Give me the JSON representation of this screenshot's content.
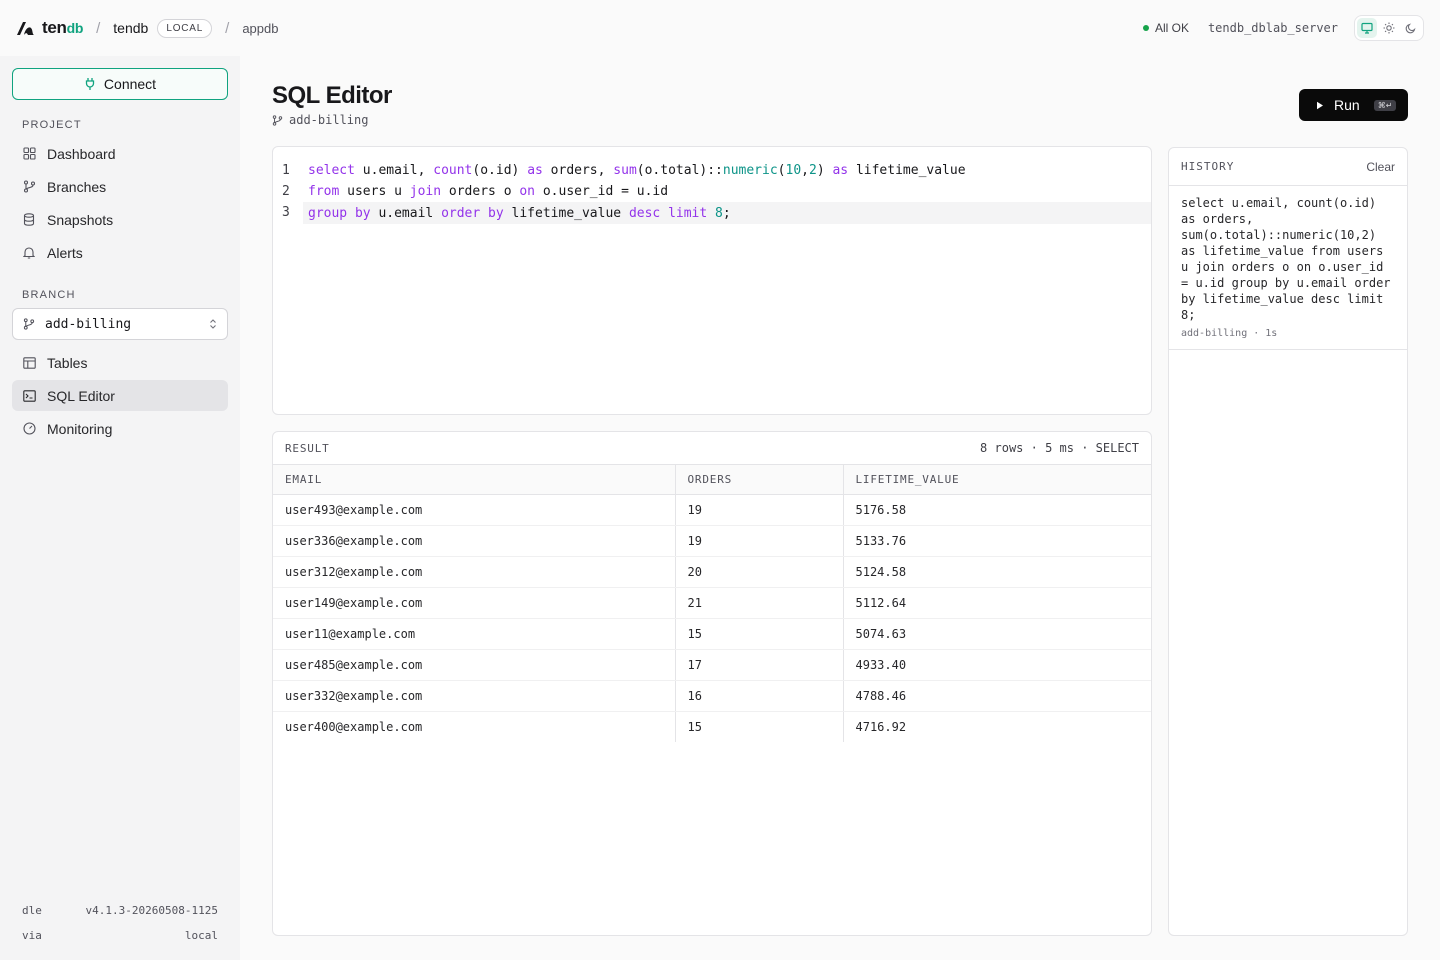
{
  "topbar": {
    "logo_ten": "ten",
    "logo_db": "db",
    "project": "tendb",
    "env_badge": "LOCAL",
    "database": "appdb",
    "status": "All OK",
    "server": "tendb_dblab_server"
  },
  "sidebar": {
    "connect_label": "Connect",
    "project_section": "PROJECT",
    "project_items": [
      {
        "label": "Dashboard"
      },
      {
        "label": "Branches"
      },
      {
        "label": "Snapshots"
      },
      {
        "label": "Alerts"
      }
    ],
    "branch_section": "BRANCH",
    "branch_selected": "add-billing",
    "branch_items": [
      {
        "label": "Tables"
      },
      {
        "label": "SQL Editor"
      },
      {
        "label": "Monitoring"
      }
    ],
    "footer": [
      {
        "key": "dle",
        "value": "v4.1.3-20260508-1125"
      },
      {
        "key": "via",
        "value": "local"
      }
    ]
  },
  "main": {
    "title": "SQL Editor",
    "branch": "add-billing",
    "run_label": "Run",
    "run_shortcut": "⌘↵"
  },
  "editor": {
    "line_numbers": [
      "1",
      "2",
      "3"
    ],
    "lines": [
      "select u.email, count(o.id) as orders, sum(o.total)::numeric(10,2) as lifetime_value",
      "from users u join orders o on o.user_id = u.id",
      "group by u.email order by lifetime_value desc limit 8;"
    ]
  },
  "result": {
    "label": "RESULT",
    "meta": "8 rows · 5 ms · SELECT",
    "columns": [
      "EMAIL",
      "ORDERS",
      "LIFETIME_VALUE"
    ],
    "rows": [
      [
        "user493@example.com",
        "19",
        "5176.58"
      ],
      [
        "user336@example.com",
        "19",
        "5133.76"
      ],
      [
        "user312@example.com",
        "20",
        "5124.58"
      ],
      [
        "user149@example.com",
        "21",
        "5112.64"
      ],
      [
        "user11@example.com",
        "15",
        "5074.63"
      ],
      [
        "user485@example.com",
        "17",
        "4933.40"
      ],
      [
        "user332@example.com",
        "16",
        "4788.46"
      ],
      [
        "user400@example.com",
        "15",
        "4716.92"
      ]
    ]
  },
  "history": {
    "label": "HISTORY",
    "clear_label": "Clear",
    "items": [
      {
        "sql": "select u.email, count(o.id) as orders, sum(o.total)::numeric(10,2) as lifetime_value from users u join orders o on o.user_id = u.id group by u.email order by lifetime_value desc limit 8;",
        "meta": "add-billing · 1s"
      }
    ]
  },
  "colors": {
    "accent": "#10a37f",
    "keyword": "#9333ea",
    "type": "#0d9488",
    "status_ok": "#16a34a"
  },
  "icons": {
    "logo": "tendb-logo-icon",
    "connect": "plug-icon",
    "dashboard": "grid-icon",
    "branches": "git-branch-icon",
    "snapshots": "database-icon",
    "alerts": "bell-icon",
    "tables": "table-icon",
    "sql_editor": "terminal-icon",
    "monitoring": "gauge-icon",
    "run": "play-icon",
    "theme": [
      "monitor-icon",
      "sun-icon",
      "moon-icon"
    ]
  }
}
